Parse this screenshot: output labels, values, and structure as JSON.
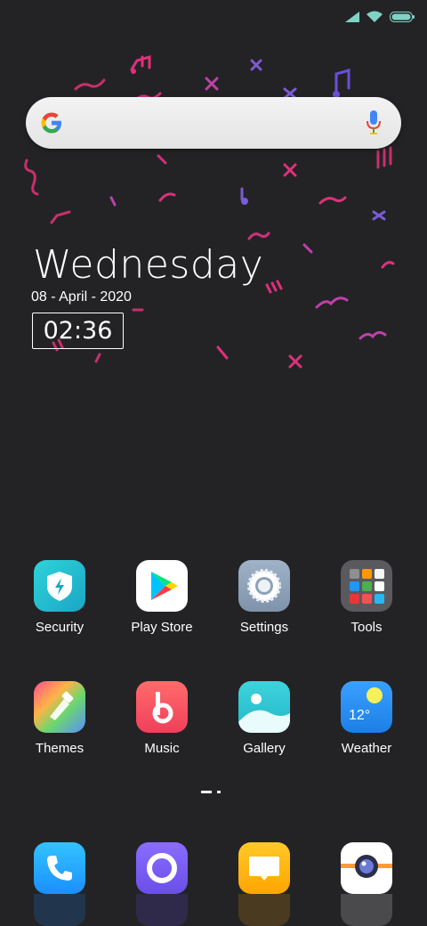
{
  "status_bar": {
    "icons": [
      "signal-icon",
      "wifi-icon",
      "battery-icon"
    ]
  },
  "search": {
    "logo": "google-g-icon",
    "voice": "microphone-icon"
  },
  "date_widget": {
    "day": "Wednesday",
    "date": "08 - April - 2020",
    "time": "02:36"
  },
  "apps_row1": [
    {
      "label": "Security",
      "icon": "shield-icon"
    },
    {
      "label": "Play Store",
      "icon": "play-store-icon"
    },
    {
      "label": "Settings",
      "icon": "gear-icon"
    },
    {
      "label": "Tools",
      "icon": "folder-icon"
    }
  ],
  "apps_row2": [
    {
      "label": "Themes",
      "icon": "paintbrush-icon"
    },
    {
      "label": "Music",
      "icon": "music-icon"
    },
    {
      "label": "Gallery",
      "icon": "gallery-icon"
    },
    {
      "label": "Weather",
      "icon": "weather-icon",
      "temperature": "12°"
    }
  ],
  "dock": [
    {
      "icon": "phone-icon"
    },
    {
      "icon": "messaging-icon"
    },
    {
      "icon": "messages-icon"
    },
    {
      "icon": "camera-icon"
    }
  ],
  "colors": {
    "background": "#232326",
    "accent_pink": "#e0307a",
    "accent_purple": "#7b5bd6"
  }
}
